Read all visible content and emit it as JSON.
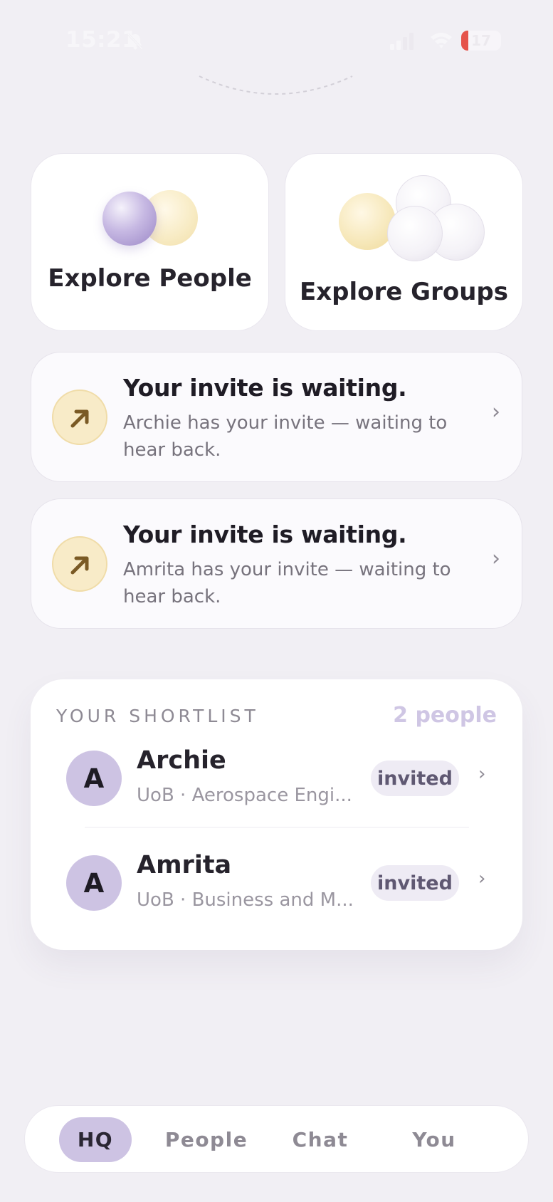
{
  "status_bar": {
    "time": "15:21",
    "battery_level": "17",
    "battery_fraction": 0.17,
    "battery_color": "#e5534b",
    "icons": [
      "bell-off-icon",
      "signal-icon",
      "wifi-icon",
      "battery-icon"
    ]
  },
  "explore": {
    "people_label": "Explore People",
    "groups_label": "Explore Groups"
  },
  "invites": [
    {
      "title": "Your invite is waiting.",
      "subtitle": "Archie has your invite — waiting to hear back.",
      "icon": "arrow-up-right-icon"
    },
    {
      "title": "Your invite is waiting.",
      "subtitle": "Amrita has your invite — waiting to hear back.",
      "icon": "arrow-up-right-icon"
    }
  ],
  "shortlist": {
    "title": "YOUR SHORTLIST",
    "count": "2 people",
    "people": [
      {
        "initial": "A",
        "name": "Archie",
        "detail": "UoB · Aerospace Engi...",
        "status": "invited"
      },
      {
        "initial": "A",
        "name": "Amrita",
        "detail": "UoB · Business and M...",
        "status": "invited"
      }
    ]
  },
  "chevron": "›",
  "tabs": [
    {
      "label": "HQ",
      "active": true
    },
    {
      "label": "People",
      "active": false
    },
    {
      "label": "Chat",
      "active": false
    },
    {
      "label": "You",
      "active": false
    }
  ],
  "colors": {
    "background": "#f1eff4",
    "accent_lilac": "#cdc3e3",
    "invite_icon_bg": "#f8ebc8",
    "invite_arrow": "#7a5a25"
  }
}
